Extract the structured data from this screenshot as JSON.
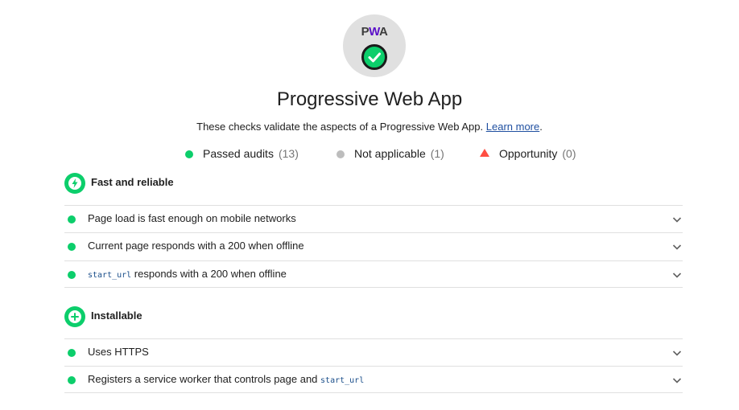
{
  "header": {
    "logo_text_p": "P",
    "logo_text_w": "W",
    "logo_text_a": "A",
    "title": "Progressive Web App",
    "description": "These checks validate the aspects of a Progressive Web App.",
    "learn_more": "Learn more",
    "description_end": "."
  },
  "legend": [
    {
      "label": "Passed audits",
      "count": "(13)",
      "color": "#0cce6b",
      "shape": "circle"
    },
    {
      "label": "Not applicable",
      "count": "(1)",
      "color": "#bdbdbd",
      "shape": "circle"
    },
    {
      "label": "Opportunity",
      "count": "(0)",
      "color": "#ff4e42",
      "shape": "triangle"
    }
  ],
  "groups": [
    {
      "title": "Fast and reliable",
      "icon": "lightning-bolt-icon",
      "audits": [
        {
          "pre": "Page load is fast enough on mobile networks",
          "code": "",
          "post": ""
        },
        {
          "pre": "Current page responds with a 200 when offline",
          "code": "",
          "post": ""
        },
        {
          "pre": "",
          "code": "start_url",
          "post": " responds with a 200 when offline"
        }
      ]
    },
    {
      "title": "Installable",
      "icon": "plus-icon",
      "audits": [
        {
          "pre": "Uses HTTPS",
          "code": "",
          "post": ""
        },
        {
          "pre": "Registers a service worker that controls page and ",
          "code": "start_url",
          "post": ""
        }
      ]
    }
  ],
  "colors": {
    "pass": "#0cce6b",
    "gauge_bg": "#e0e0e0",
    "link": "#1f4fa0",
    "pwa_purple": "#5a0fc8"
  }
}
